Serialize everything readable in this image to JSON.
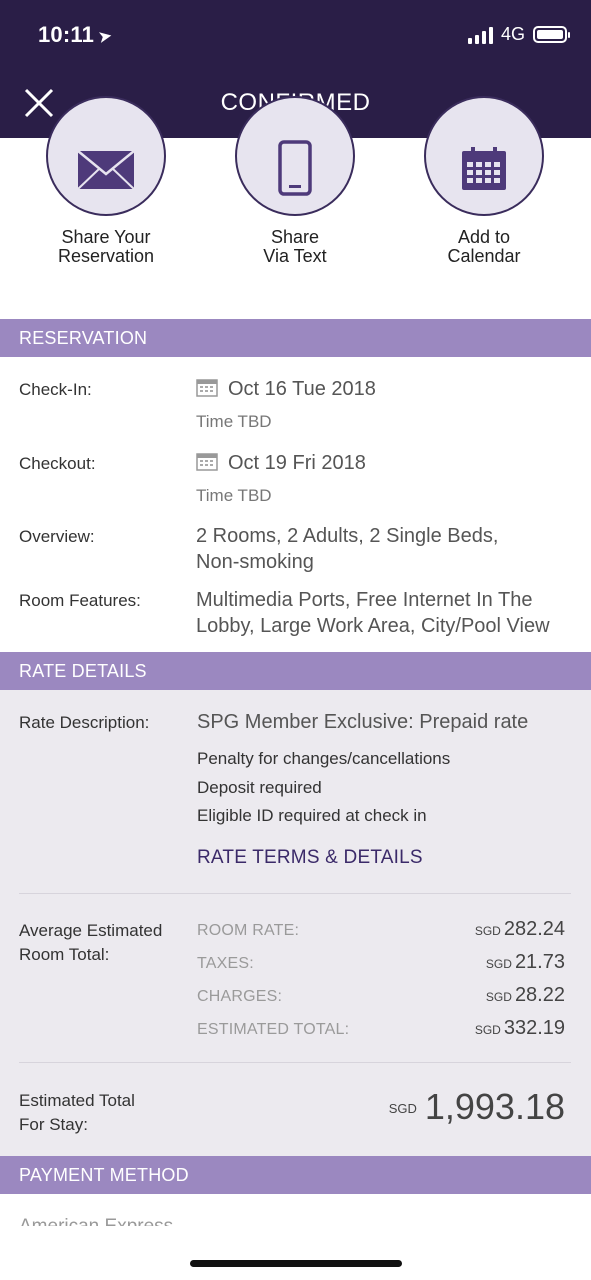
{
  "status_bar": {
    "time": "10:11",
    "network": "4G"
  },
  "header": {
    "title": "CONFIRMED"
  },
  "actions": [
    {
      "label": "Share Your\nReservation",
      "icon": "envelope-icon"
    },
    {
      "label": "Share\nVia Text",
      "icon": "phone-icon"
    },
    {
      "label": "Add to\nCalendar",
      "icon": "calendar-icon"
    }
  ],
  "reservation": {
    "section_title": "RESERVATION",
    "checkin_label": "Check-In:",
    "checkin_date": "Oct 16 Tue 2018",
    "checkin_time": "Time TBD",
    "checkout_label": "Checkout:",
    "checkout_date": "Oct 19 Fri 2018",
    "checkout_time": "Time TBD",
    "overview_label": "Overview:",
    "overview_line1": "2 Rooms, 2 Adults, 2 Single Beds,",
    "overview_line2": "Non-smoking",
    "features_label": "Room Features:",
    "features_line1": "Multimedia Ports, Free Internet In The",
    "features_line2": "Lobby, Large Work Area, City/Pool View"
  },
  "rate_details": {
    "section_title": "RATE DETAILS",
    "description_label": "Rate Description:",
    "description": "SPG Member Exclusive: Prepaid rate",
    "policies": [
      "Penalty for changes/cancellations",
      "Deposit required",
      "Eligible ID required at check in"
    ],
    "terms_link": "RATE TERMS & DETAILS",
    "avg_label_line1": "Average Estimated",
    "avg_label_line2": "Room Total:",
    "currency": "SGD",
    "lines": [
      {
        "label": "ROOM RATE:",
        "amount": "282.24"
      },
      {
        "label": "TAXES:",
        "amount": "21.73"
      },
      {
        "label": "CHARGES:",
        "amount": "28.22"
      },
      {
        "label": "ESTIMATED TOTAL:",
        "amount": "332.19"
      }
    ],
    "stay_label_line1": "Estimated Total",
    "stay_label_line2": "For Stay:",
    "stay_total": "1,993.18"
  },
  "payment": {
    "section_title": "PAYMENT METHOD",
    "card": "American Express"
  }
}
